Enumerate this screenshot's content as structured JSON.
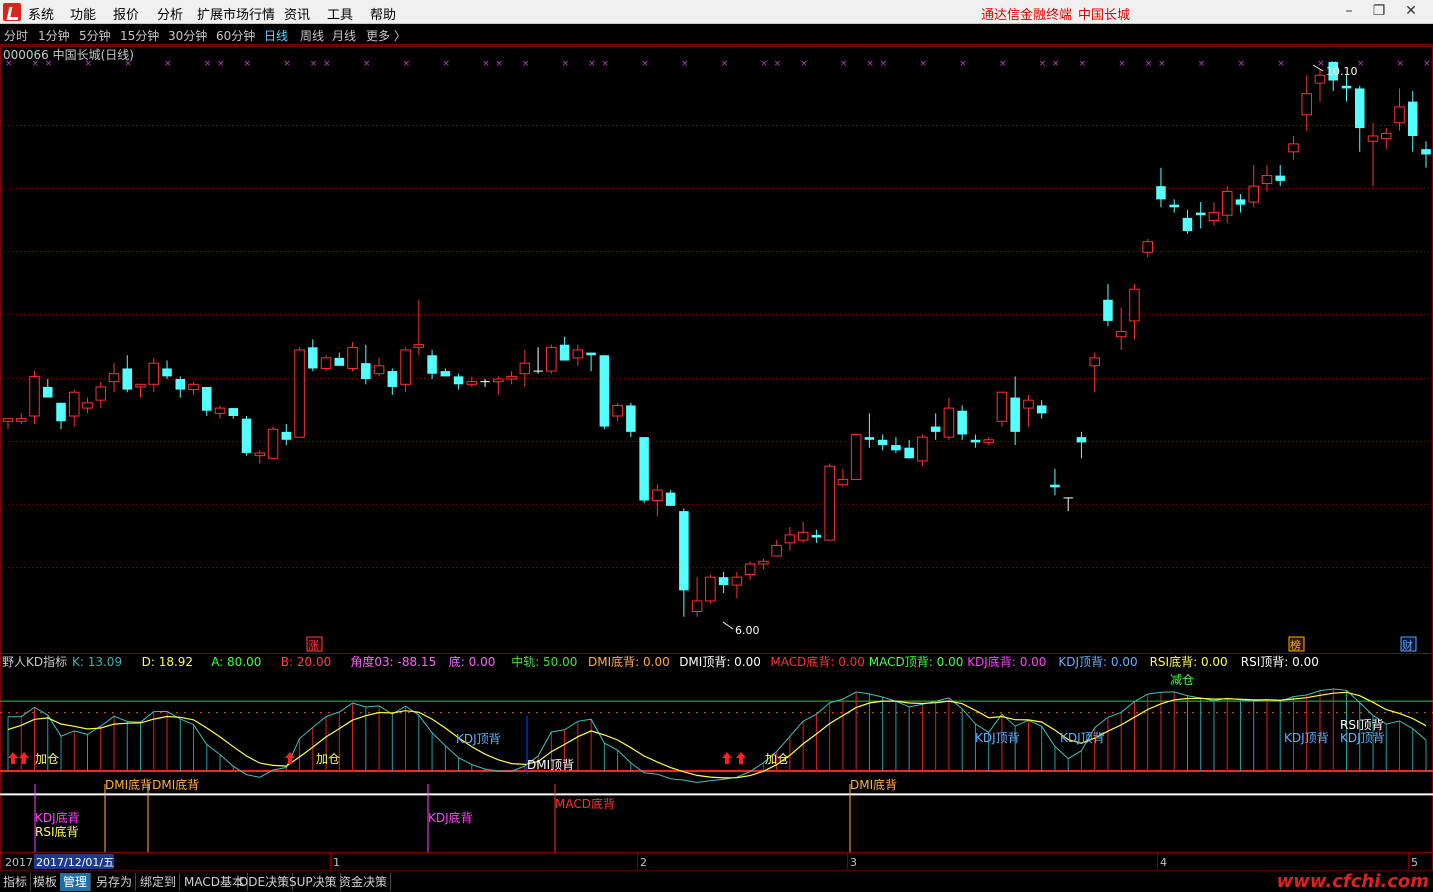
{
  "menu": {
    "items": [
      "系统",
      "功能",
      "报价",
      "分析",
      "扩展市场行情",
      "资讯",
      "工具",
      "帮助"
    ],
    "brand": "通达信金融终端",
    "stock_name": "中国长城"
  },
  "periods": {
    "items": [
      "分时",
      "1分钟",
      "5分钟",
      "15分钟",
      "30分钟",
      "60分钟",
      "日线",
      "周线",
      "月线",
      "更多 〉"
    ],
    "active_index": 6
  },
  "main_chart": {
    "title": "000066 中国长城(日线)",
    "price_high_label": "10.10",
    "price_low_label": "6.00",
    "markers": [
      {
        "text": "涨",
        "color": "#ff4040"
      },
      {
        "text": "榜",
        "color": "#ffb000"
      },
      {
        "text": "财",
        "color": "#60a0ff"
      }
    ]
  },
  "indicator": {
    "name": "野人KD指标",
    "readouts": [
      {
        "label": "K:",
        "value": "13.09",
        "color": "#3cb4b4"
      },
      {
        "label": "D:",
        "value": "18.92",
        "color": "#ffff40"
      },
      {
        "label": "A:",
        "value": "80.00",
        "color": "#40ff40"
      },
      {
        "label": "B:",
        "value": "20.00",
        "color": "#ff4040"
      },
      {
        "label": "角度03:",
        "value": "-88.15",
        "color": "#ff60ff"
      },
      {
        "label": "底:",
        "value": "0.00",
        "color": "#ff60ff"
      },
      {
        "label": "中轨:",
        "value": "50.00",
        "color": "#40e040"
      },
      {
        "label": "DMI底背:",
        "value": "0.00",
        "color": "#ffb040"
      },
      {
        "label": "DMI顶背:",
        "value": "0.00",
        "color": "#ffffff"
      },
      {
        "label": "MACD底背:",
        "value": "0.00",
        "color": "#ff3030"
      },
      {
        "label": "MACD顶背:",
        "value": "0.00",
        "color": "#40ff40"
      },
      {
        "label": "KDJ底背:",
        "value": "0.00",
        "color": "#ff40ff"
      },
      {
        "label": "KDJ顶背:",
        "value": "0.00",
        "color": "#60b0ff"
      },
      {
        "label": "RSI底背:",
        "value": "0.00",
        "color": "#ffff40"
      },
      {
        "label": "RSI顶背:",
        "value": "0.00",
        "color": "#ffffff"
      }
    ],
    "signals": [
      {
        "text": "加仓",
        "color": "#ffff40"
      },
      {
        "text": "加仓",
        "color": "#ffff40"
      },
      {
        "text": "加仓",
        "color": "#ffff40"
      },
      {
        "text": "减仓",
        "color": "#40ff40"
      },
      {
        "text": "KDJ顶背",
        "color": "#60b0ff"
      },
      {
        "text": "KDJ顶背",
        "color": "#60b0ff"
      },
      {
        "text": "KDJ顶背",
        "color": "#60b0ff"
      },
      {
        "text": "KDJ顶背",
        "color": "#60b0ff"
      },
      {
        "text": "KDJ顶背",
        "color": "#60b0ff"
      },
      {
        "text": "RSI顶背",
        "color": "#ffffff"
      },
      {
        "text": "DMI顶背",
        "color": "#ffffff"
      },
      {
        "text": "DMI底背DMI底背",
        "color": "#ffb040"
      },
      {
        "text": "DMI底背",
        "color": "#ffb040"
      },
      {
        "text": "KDJ底背",
        "color": "#ff40ff"
      },
      {
        "text": "RSI底背",
        "color": "#ffff40"
      },
      {
        "text": "KDJ底背",
        "color": "#ff40ff"
      },
      {
        "text": "MACD底背",
        "color": "#ff3030"
      }
    ]
  },
  "time_axis": {
    "year": "2017",
    "cursor_date": "2017/12/01/五",
    "months": [
      "1",
      "2",
      "3",
      "4",
      "5"
    ]
  },
  "bottom_tabs": {
    "items": [
      "指标",
      "模板",
      "管理",
      "另存为",
      "绑定到",
      "MACD基本",
      "DDE决策",
      "SUP决策",
      "资金决策"
    ],
    "active_index": 2
  },
  "watermark": "www.cfchi.com",
  "chart_data": [
    {
      "type": "candlestick",
      "title": "000066 中国长城(日线)",
      "price_high": 10.1,
      "price_low": 6.0,
      "ylim": [
        5.9,
        10.2
      ],
      "grid": "dotted-horizontal",
      "candles": [
        [
          7.48,
          7.5,
          7.42,
          7.5
        ],
        [
          7.48,
          7.54,
          7.46,
          7.5
        ],
        [
          7.52,
          7.86,
          7.46,
          7.82
        ],
        [
          7.74,
          7.8,
          7.66,
          7.66
        ],
        [
          7.62,
          7.62,
          7.42,
          7.48
        ],
        [
          7.52,
          7.72,
          7.44,
          7.7
        ],
        [
          7.58,
          7.66,
          7.54,
          7.62
        ],
        [
          7.64,
          7.78,
          7.58,
          7.74
        ],
        [
          7.78,
          7.92,
          7.7,
          7.84
        ],
        [
          7.88,
          7.98,
          7.7,
          7.72
        ],
        [
          7.74,
          7.76,
          7.66,
          7.76
        ],
        [
          7.76,
          7.96,
          7.7,
          7.92
        ],
        [
          7.88,
          7.94,
          7.8,
          7.82
        ],
        [
          7.8,
          7.82,
          7.66,
          7.72
        ],
        [
          7.72,
          7.78,
          7.68,
          7.76
        ],
        [
          7.74,
          7.74,
          7.52,
          7.56
        ],
        [
          7.54,
          7.6,
          7.5,
          7.58
        ],
        [
          7.58,
          7.58,
          7.5,
          7.52
        ],
        [
          7.5,
          7.52,
          7.22,
          7.24
        ],
        [
          7.22,
          7.26,
          7.16,
          7.24
        ],
        [
          7.2,
          7.44,
          7.2,
          7.42
        ],
        [
          7.4,
          7.46,
          7.3,
          7.34
        ],
        [
          7.36,
          8.04,
          7.36,
          8.02
        ],
        [
          8.04,
          8.1,
          7.86,
          7.88
        ],
        [
          7.88,
          7.98,
          7.86,
          7.96
        ],
        [
          7.96,
          8.0,
          7.9,
          7.9
        ],
        [
          7.88,
          8.08,
          7.86,
          8.04
        ],
        [
          7.92,
          8.06,
          7.76,
          7.8
        ],
        [
          7.84,
          7.96,
          7.82,
          7.9
        ],
        [
          7.86,
          7.88,
          7.68,
          7.74
        ],
        [
          7.76,
          8.04,
          7.7,
          8.02
        ],
        [
          8.04,
          8.4,
          7.98,
          8.06
        ],
        [
          7.98,
          8.02,
          7.8,
          7.84
        ],
        [
          7.86,
          7.88,
          7.82,
          7.82
        ],
        [
          7.82,
          7.84,
          7.72,
          7.76
        ],
        [
          7.76,
          7.82,
          7.74,
          7.78
        ],
        [
          7.78,
          7.8,
          7.74,
          7.78
        ],
        [
          7.78,
          7.82,
          7.68,
          7.8
        ],
        [
          7.8,
          7.86,
          7.76,
          7.82
        ],
        [
          7.84,
          8.02,
          7.74,
          7.92
        ],
        [
          7.86,
          8.04,
          7.84,
          7.86
        ],
        [
          7.86,
          8.06,
          7.84,
          8.04
        ],
        [
          8.06,
          8.12,
          7.94,
          7.94
        ],
        [
          7.96,
          8.06,
          7.9,
          8.02
        ],
        [
          8.0,
          8.0,
          7.86,
          7.98
        ],
        [
          7.98,
          7.98,
          7.42,
          7.44
        ],
        [
          7.52,
          7.62,
          7.48,
          7.6
        ],
        [
          7.6,
          7.62,
          7.36,
          7.4
        ],
        [
          7.36,
          7.36,
          6.86,
          6.88
        ],
        [
          6.88,
          7.0,
          6.76,
          6.96
        ],
        [
          6.94,
          6.96,
          6.84,
          6.84
        ],
        [
          6.8,
          6.82,
          6.0,
          6.2
        ],
        [
          6.04,
          6.3,
          6.0,
          6.12
        ],
        [
          6.12,
          6.32,
          6.1,
          6.3
        ],
        [
          6.3,
          6.34,
          6.18,
          6.24
        ],
        [
          6.24,
          6.34,
          6.14,
          6.3
        ],
        [
          6.32,
          6.42,
          6.28,
          6.4
        ],
        [
          6.4,
          6.44,
          6.36,
          6.42
        ],
        [
          6.46,
          6.58,
          6.46,
          6.54
        ],
        [
          6.56,
          6.68,
          6.5,
          6.62
        ],
        [
          6.58,
          6.72,
          6.56,
          6.64
        ],
        [
          6.62,
          6.66,
          6.56,
          6.6
        ],
        [
          6.58,
          7.16,
          6.58,
          7.14
        ],
        [
          7.0,
          7.12,
          6.98,
          7.04
        ],
        [
          7.04,
          7.38,
          7.04,
          7.38
        ],
        [
          7.36,
          7.54,
          7.28,
          7.34
        ],
        [
          7.34,
          7.38,
          7.26,
          7.3
        ],
        [
          7.3,
          7.36,
          7.24,
          7.26
        ],
        [
          7.28,
          7.34,
          7.2,
          7.2
        ],
        [
          7.18,
          7.38,
          7.14,
          7.36
        ],
        [
          7.44,
          7.54,
          7.34,
          7.4
        ],
        [
          7.36,
          7.66,
          7.34,
          7.58
        ],
        [
          7.56,
          7.6,
          7.34,
          7.38
        ],
        [
          7.34,
          7.38,
          7.28,
          7.32
        ],
        [
          7.32,
          7.36,
          7.3,
          7.34
        ],
        [
          7.48,
          7.7,
          7.44,
          7.7
        ],
        [
          7.66,
          7.82,
          7.3,
          7.4
        ],
        [
          7.58,
          7.68,
          7.44,
          7.64
        ],
        [
          7.6,
          7.64,
          7.5,
          7.54
        ],
        [
          7.0,
          7.12,
          6.92,
          6.98
        ],
        [
          6.9,
          6.9,
          6.8,
          6.9
        ],
        [
          7.36,
          7.4,
          7.2,
          7.32
        ],
        [
          7.9,
          8.0,
          7.7,
          7.96
        ],
        [
          8.4,
          8.52,
          8.2,
          8.24
        ],
        [
          8.12,
          8.34,
          8.02,
          8.16
        ],
        [
          8.24,
          8.52,
          8.1,
          8.48
        ],
        [
          8.76,
          8.86,
          8.72,
          8.84
        ],
        [
          9.26,
          9.4,
          9.1,
          9.16
        ],
        [
          9.12,
          9.16,
          9.06,
          9.1
        ],
        [
          9.02,
          9.08,
          8.9,
          8.92
        ],
        [
          9.06,
          9.14,
          8.94,
          9.04
        ],
        [
          9.0,
          9.14,
          8.96,
          9.06
        ],
        [
          9.04,
          9.26,
          8.98,
          9.22
        ],
        [
          9.16,
          9.2,
          9.06,
          9.12
        ],
        [
          9.14,
          9.42,
          9.1,
          9.26
        ],
        [
          9.28,
          9.42,
          9.22,
          9.34
        ],
        [
          9.34,
          9.42,
          9.26,
          9.3
        ],
        [
          9.52,
          9.64,
          9.46,
          9.58
        ],
        [
          9.8,
          10.1,
          9.68,
          9.96
        ],
        [
          10.04,
          10.14,
          9.9,
          10.1
        ],
        [
          10.2,
          10.1,
          9.98,
          10.06
        ],
        [
          10.02,
          10.1,
          9.9,
          10.0
        ],
        [
          10.0,
          10.02,
          9.52,
          9.7
        ],
        [
          9.6,
          9.74,
          9.26,
          9.64
        ],
        [
          9.62,
          9.7,
          9.54,
          9.66
        ],
        [
          9.74,
          10.0,
          9.68,
          9.86
        ],
        [
          9.9,
          9.98,
          9.52,
          9.64
        ],
        [
          9.54,
          9.6,
          9.4,
          9.5
        ]
      ]
    },
    {
      "type": "line",
      "title": "野人KD指标",
      "ylim": [
        -10,
        105
      ],
      "guides": {
        "A": 80.0,
        "B": 20.0,
        "mid": 50.0
      },
      "last_values": {
        "K": 13.09,
        "D": 18.92,
        "angle03": -88.15
      }
    }
  ]
}
